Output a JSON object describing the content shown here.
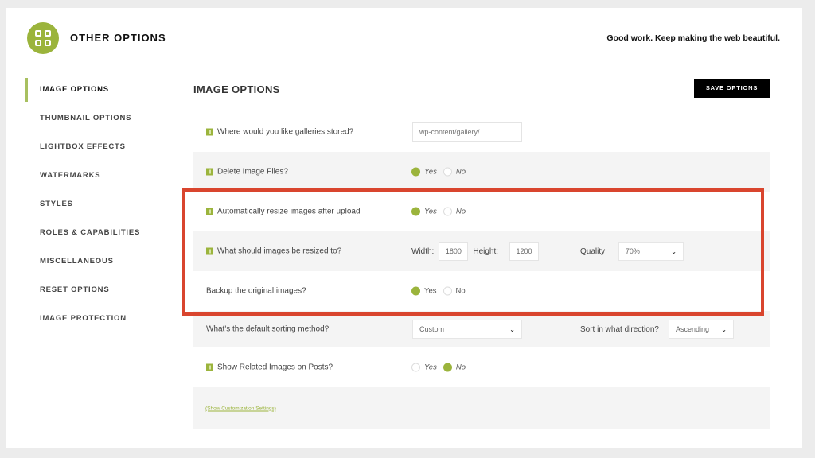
{
  "header": {
    "logo_icon": "grid-icon",
    "title": "OTHER OPTIONS",
    "tagline": "Good work. Keep making the web beautiful."
  },
  "sidebar": {
    "items": [
      {
        "label": "IMAGE OPTIONS",
        "active": true
      },
      {
        "label": "THUMBNAIL OPTIONS"
      },
      {
        "label": "LIGHTBOX EFFECTS"
      },
      {
        "label": "WATERMARKS"
      },
      {
        "label": "STYLES"
      },
      {
        "label": "ROLES & CAPABILITIES"
      },
      {
        "label": "MISCELLANEOUS"
      },
      {
        "label": "RESET OPTIONS"
      },
      {
        "label": "IMAGE PROTECTION"
      }
    ]
  },
  "main": {
    "section_title": "IMAGE OPTIONS",
    "save_label": "SAVE OPTIONS",
    "gallery_path": {
      "label": "Where would you like galleries stored?",
      "value": "wp-content/gallery/"
    },
    "delete_files": {
      "label": "Delete Image Files?",
      "yes": "Yes",
      "no": "No",
      "selected": "Yes"
    },
    "auto_resize": {
      "label": "Automatically resize images after upload",
      "yes": "Yes",
      "no": "No",
      "selected": "Yes"
    },
    "resize_to": {
      "label": "What should images be resized to?",
      "width_label": "Width:",
      "width_value": "1800",
      "height_label": "Height:",
      "height_value": "1200",
      "quality_label": "Quality:",
      "quality_value": "70%"
    },
    "backup": {
      "label": "Backup the original images?",
      "yes": "Yes",
      "no": "No",
      "selected": "Yes"
    },
    "sorting": {
      "label": "What's the default sorting method?",
      "value": "Custom",
      "direction_label": "Sort in what direction?",
      "direction_value": "Ascending"
    },
    "related": {
      "label": "Show Related Images on Posts?",
      "yes": "Yes",
      "no": "No",
      "selected": "No"
    },
    "customization_link": "(Show Customization Settings)"
  },
  "colors": {
    "accent": "#9bb43c",
    "highlight": "#d9452e"
  }
}
